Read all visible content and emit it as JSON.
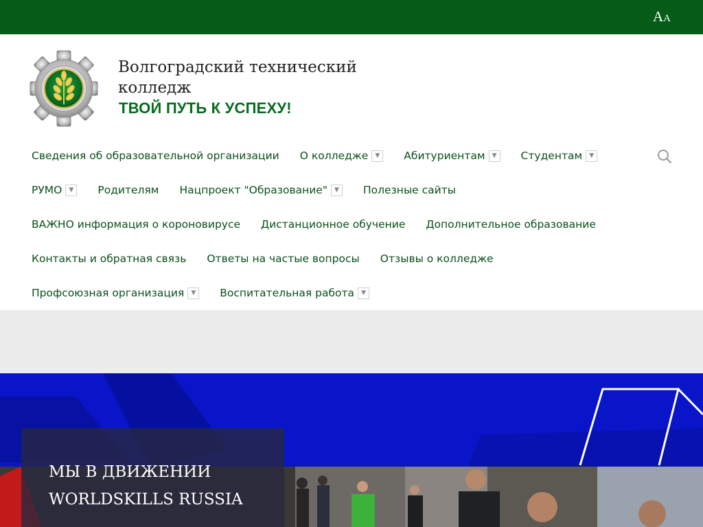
{
  "topbar": {
    "font_toggle_large": "A",
    "font_toggle_small": "A",
    "color": "#045c16"
  },
  "header": {
    "title_line1": "Волгоградский технический",
    "title_line2": "колледж",
    "slogan": "ТВОЙ ПУТЬ К УСПЕХУ!",
    "logo_icon": "college-emblem-icon"
  },
  "nav": {
    "rows": [
      [
        {
          "label": "Сведения об образовательной организации",
          "dropdown": false
        },
        {
          "label": "О колледже",
          "dropdown": true
        },
        {
          "label": "Абитуриентам",
          "dropdown": true
        },
        {
          "label": "Студентам",
          "dropdown": true
        }
      ],
      [
        {
          "label": "РУМО",
          "dropdown": true
        },
        {
          "label": "Родителям",
          "dropdown": false
        },
        {
          "label": "Нацпроект \"Образование\"",
          "dropdown": true
        },
        {
          "label": "Полезные сайты",
          "dropdown": false
        }
      ],
      [
        {
          "label": "ВАЖНО информация о короновирусе",
          "dropdown": false
        },
        {
          "label": "Дистанционное обучение",
          "dropdown": false
        },
        {
          "label": "Дополнительное образование",
          "dropdown": false
        }
      ],
      [
        {
          "label": "Контакты и обратная связь",
          "dropdown": false
        },
        {
          "label": "Ответы на частые вопросы",
          "dropdown": false
        },
        {
          "label": "Отзывы о колледже",
          "dropdown": false
        }
      ],
      [
        {
          "label": "Профсоюзная организация",
          "dropdown": true
        },
        {
          "label": "Воспитательная работа",
          "dropdown": true
        }
      ]
    ],
    "search_icon": "search-icon",
    "link_color": "#0b4f1a"
  },
  "banner": {
    "title_line1": "МЫ В ДВИЖЕНИИ",
    "title_line2": "WORLDSKILLS RUSSIA",
    "accent_color": "#0a14c9"
  }
}
